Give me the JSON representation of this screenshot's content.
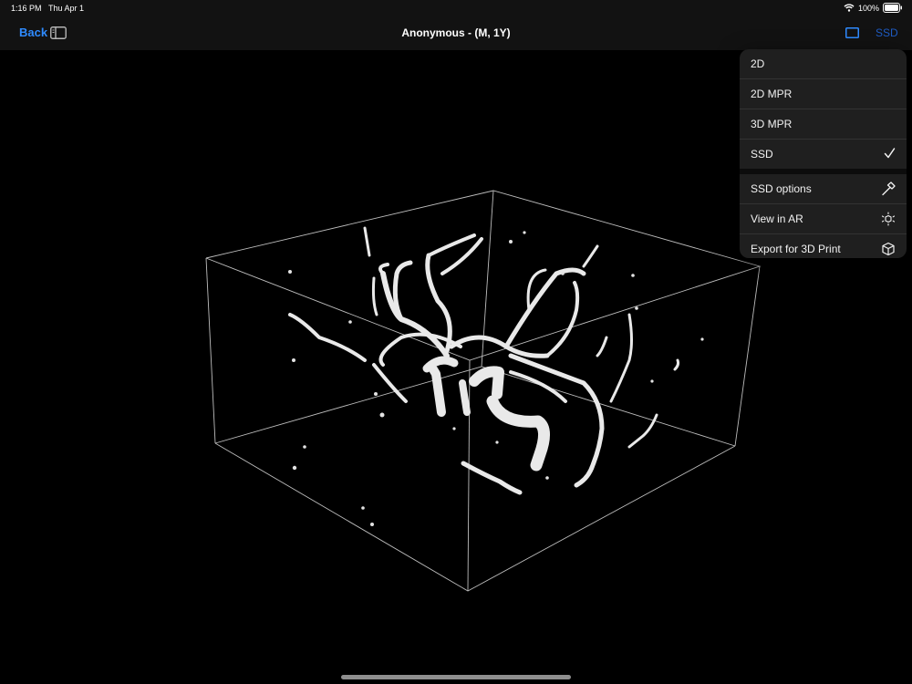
{
  "status": {
    "time": "1:16 PM",
    "date": "Thu Apr 1",
    "battery": "100%"
  },
  "nav": {
    "back_label": "Back",
    "title": "Anonymous - (M, 1Y)",
    "mode_label": "SSD"
  },
  "menu": {
    "group1": [
      {
        "label": "2D",
        "checked": false
      },
      {
        "label": "2D MPR",
        "checked": false
      },
      {
        "label": "3D MPR",
        "checked": false
      },
      {
        "label": "SSD",
        "checked": true
      }
    ],
    "group2": [
      {
        "label": "SSD options",
        "icon": "hammer-icon"
      },
      {
        "label": "View in AR",
        "icon": "ar-cube-icon"
      },
      {
        "label": "Export for 3D Print",
        "icon": "cube-icon"
      }
    ]
  },
  "colors": {
    "accent": "#2f8bff",
    "background": "#000000",
    "bar": "#121212",
    "menu": "#1f1f1f"
  }
}
